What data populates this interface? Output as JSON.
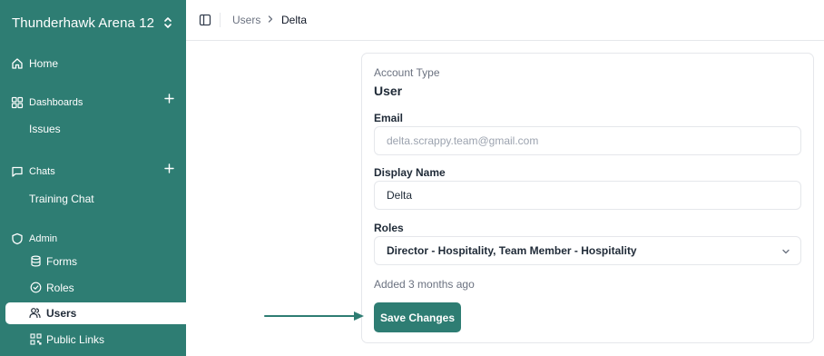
{
  "workspace": {
    "name": "Thunderhawk Arena 12"
  },
  "sidebar": {
    "home": "Home",
    "dashboards": {
      "label": "Dashboards",
      "items": [
        "Issues"
      ]
    },
    "chats": {
      "label": "Chats",
      "items": [
        "Training Chat"
      ]
    },
    "admin": {
      "label": "Admin",
      "items": [
        "Forms",
        "Roles",
        "Users",
        "Public Links"
      ]
    }
  },
  "breadcrumb": {
    "parent": "Users",
    "current": "Delta"
  },
  "user": {
    "account_type_label": "Account Type",
    "account_type": "User",
    "email_label": "Email",
    "email": "delta.scrappy.team@gmail.com",
    "display_name_label": "Display Name",
    "display_name": "Delta",
    "roles_label": "Roles",
    "roles": "Director - Hospitality, Team Member - Hospitality",
    "added": "Added 3 months ago",
    "save_label": "Save Changes"
  },
  "colors": {
    "brand": "#2e7d73",
    "arrow": "#2e7d73"
  }
}
